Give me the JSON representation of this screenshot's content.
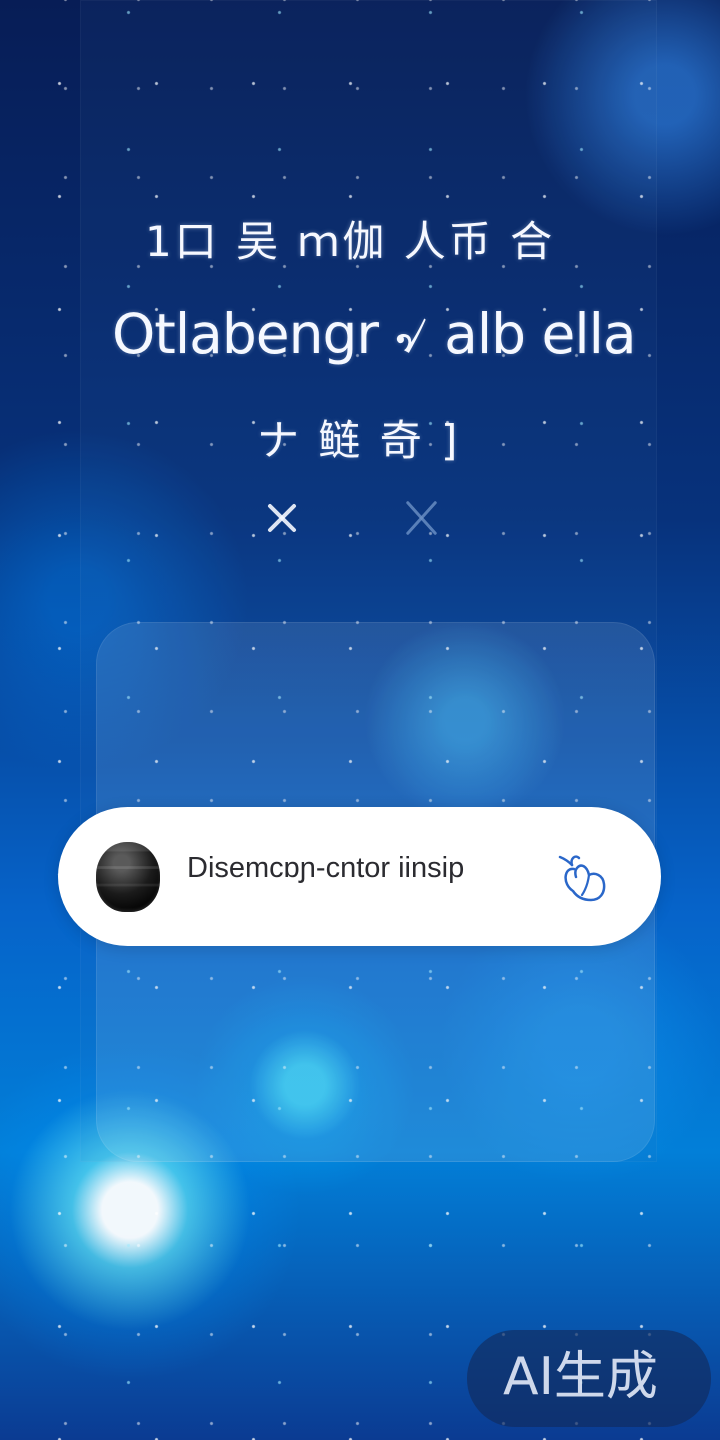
{
  "screen": {
    "title_lines": [
      "1口 吴 ｍ伽 人币 合",
      "Otlabengr ৵ alb ella",
      "ナ 鲢 奇 ]"
    ]
  },
  "search_bar": {
    "text": "Disemcɒɲ-cntor iinsip"
  },
  "watermark": {
    "text": "AI生成"
  },
  "icons": {
    "avatar": "avatar-icon",
    "close": "close-icon",
    "action": "hand-icon"
  }
}
